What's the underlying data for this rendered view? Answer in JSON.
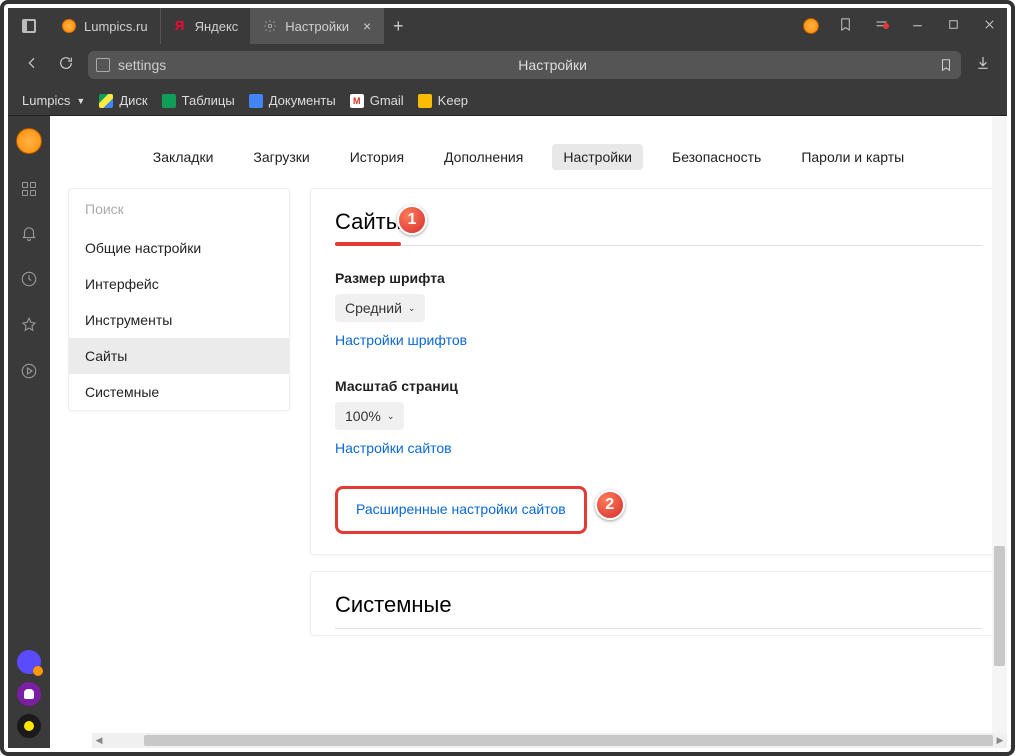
{
  "titlebar": {
    "tabs": [
      {
        "label": "Lumpics.ru"
      },
      {
        "label": "Яндекс"
      },
      {
        "label": "Настройки"
      }
    ]
  },
  "addr": {
    "url": "settings",
    "page_title": "Настройки"
  },
  "bookmarks": {
    "root": "Lumpics",
    "items": [
      "Диск",
      "Таблицы",
      "Документы",
      "Gmail",
      "Keep"
    ]
  },
  "topnav": {
    "items": [
      "Закладки",
      "Загрузки",
      "История",
      "Дополнения",
      "Настройки",
      "Безопасность",
      "Пароли и карты"
    ],
    "active": 4
  },
  "sidebar": {
    "search_placeholder": "Поиск",
    "items": [
      "Общие настройки",
      "Интерфейс",
      "Инструменты",
      "Сайты",
      "Системные"
    ],
    "active": 3
  },
  "panel1": {
    "heading": "Сайты",
    "font_label": "Размер шрифта",
    "font_value": "Средний",
    "font_link": "Настройки шрифтов",
    "zoom_label": "Масштаб страниц",
    "zoom_value": "100%",
    "zoom_link": "Настройки сайтов",
    "advanced": "Расширенные настройки сайтов"
  },
  "panel2": {
    "heading": "Системные"
  },
  "annotations": {
    "b1": "1",
    "b2": "2"
  }
}
